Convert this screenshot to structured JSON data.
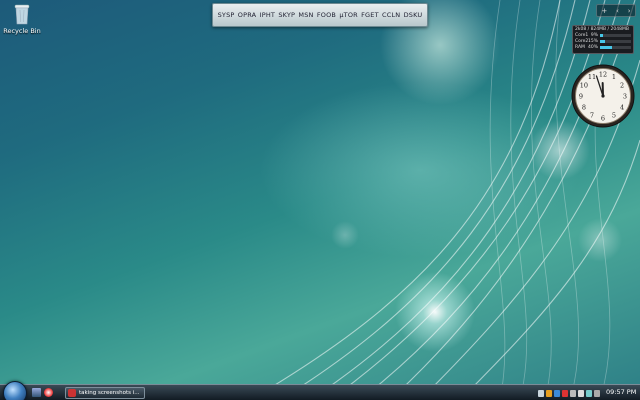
{
  "desktop": {
    "recycle_bin_label": "Recycle Bin"
  },
  "launcher": {
    "items": [
      "SYSP",
      "OPRA",
      "IPHT",
      "SKYP",
      "MSN",
      "FOOB",
      "µTOR",
      "FGET",
      "CCLN",
      "DSKU"
    ]
  },
  "gadget_controls": {
    "add": "+",
    "prev": "‹",
    "next": "›"
  },
  "meter": {
    "memory_text": "2k08 / 824MB / 2048MB",
    "rows": [
      {
        "name": "Core1",
        "percent": "9%",
        "value": 9
      },
      {
        "name": "Core2",
        "percent": "15%",
        "value": 15
      },
      {
        "name": "RAM",
        "percent": "40%",
        "value": 40
      }
    ],
    "bar_color": "#47c7e8"
  },
  "clock": {
    "hour": 11,
    "minute": 57,
    "numerals": [
      "12",
      "1",
      "2",
      "3",
      "4",
      "5",
      "6",
      "7",
      "8",
      "9",
      "10",
      "11"
    ]
  },
  "taskbar": {
    "start_icon": "windows-orb-icon",
    "task_label": "taking screenshots i...",
    "time": "09:57 PM"
  }
}
